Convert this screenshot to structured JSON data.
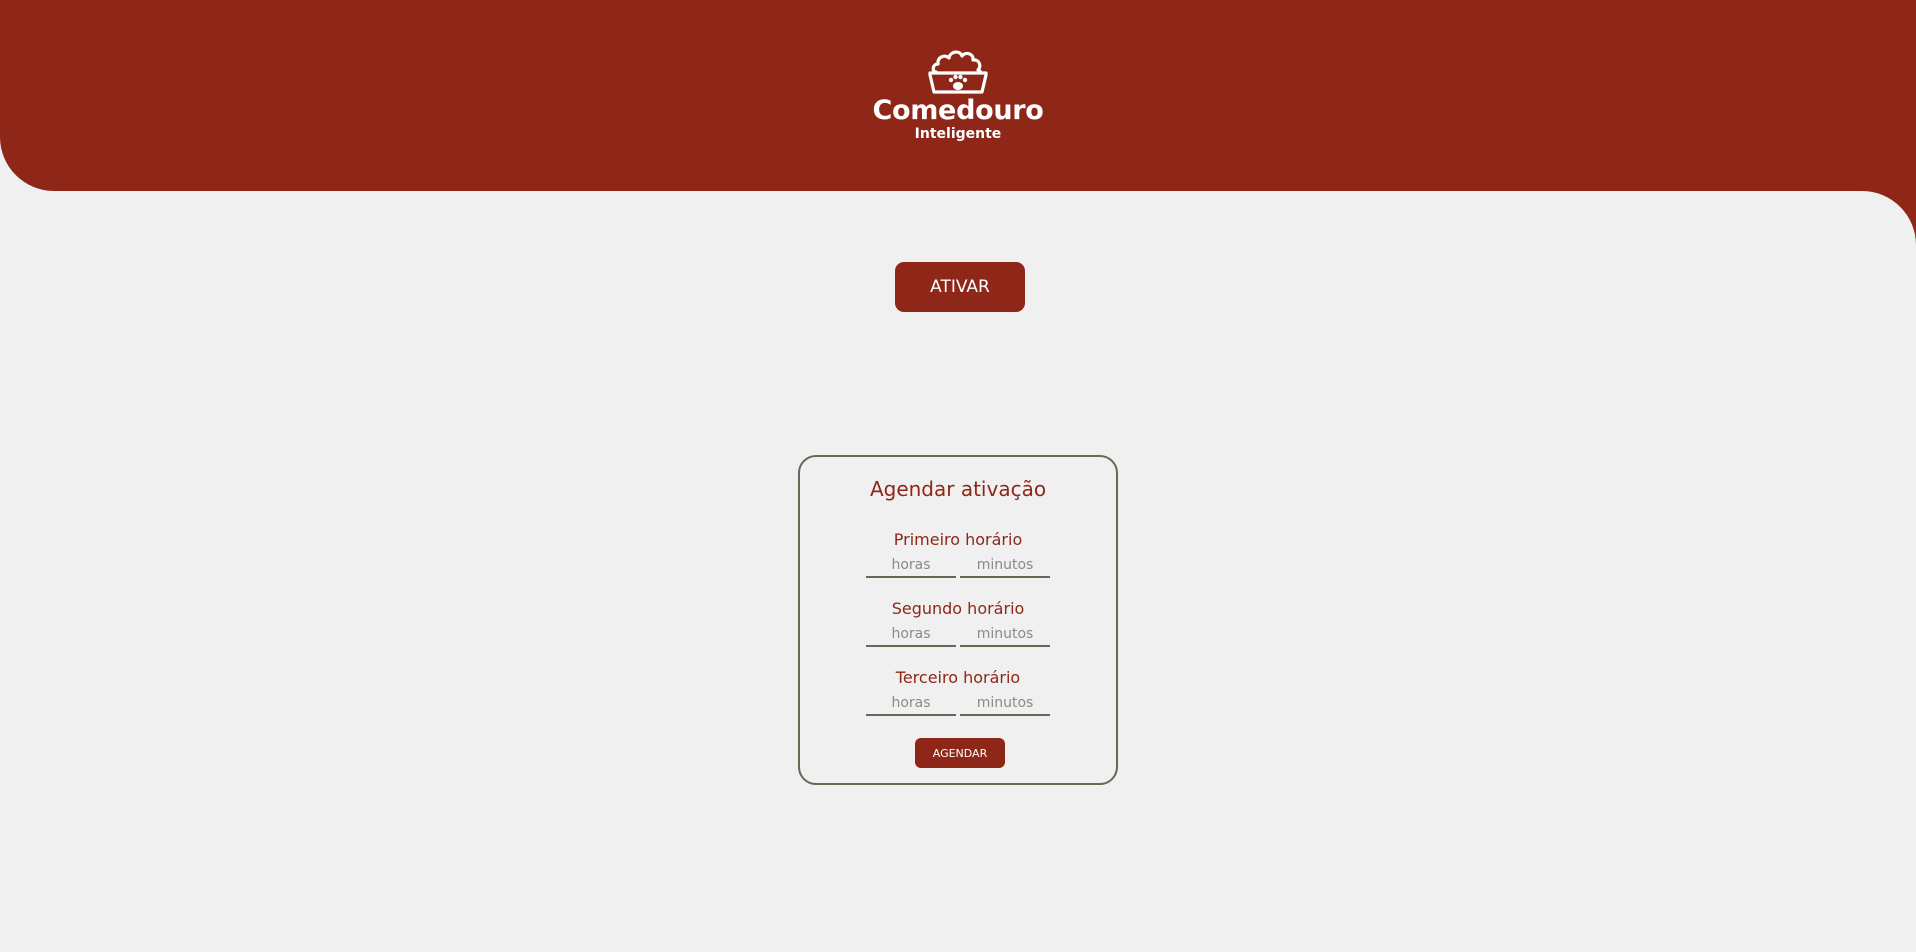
{
  "header": {
    "logo_title": "Comedouro",
    "logo_subtitle": "Inteligente",
    "logo_icon": "pet-food-bowl-icon",
    "background_color": "#8e2718"
  },
  "main": {
    "activate_label": "ATIVAR"
  },
  "schedule": {
    "title": "Agendar ativação",
    "slots": [
      {
        "label": "Primeiro horário",
        "hours_value": "",
        "minutes_value": "",
        "hours_placeholder": "horas",
        "minutes_placeholder": "minutos"
      },
      {
        "label": "Segundo horário",
        "hours_value": "",
        "minutes_value": "",
        "hours_placeholder": "horas",
        "minutes_placeholder": "minutos"
      },
      {
        "label": "Terceiro horário",
        "hours_value": "",
        "minutes_value": "",
        "hours_placeholder": "horas",
        "minutes_placeholder": "minutos"
      }
    ],
    "submit_label": "AGENDAR"
  },
  "colors": {
    "accent": "#8e2718",
    "background": "#f0f0f0",
    "border": "#6b6655"
  }
}
